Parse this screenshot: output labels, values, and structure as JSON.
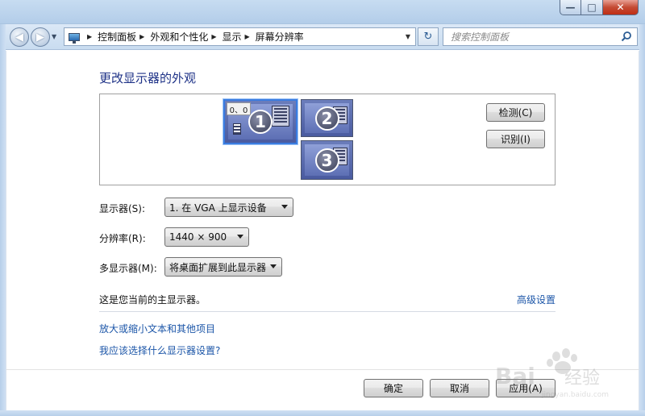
{
  "window": {
    "min_glyph": "—",
    "max_glyph": "□",
    "close_glyph": "✕"
  },
  "nav": {
    "back_glyph": "◀",
    "forward_glyph": "▶",
    "history_glyph": "▼"
  },
  "address": {
    "icon": "display-control-panel-icon",
    "breadcrumbs": [
      "控制面板",
      "外观和个性化",
      "显示",
      "屏幕分辨率"
    ],
    "dropdown_glyph": "▼",
    "refresh_glyph": "↻"
  },
  "search": {
    "placeholder": "搜索控制面板",
    "icon": "search-icon"
  },
  "main": {
    "title": "更改显示器的外观",
    "monitors": [
      {
        "number": "1",
        "selected": true,
        "coord_label": "0、0"
      },
      {
        "number": "2",
        "selected": false
      },
      {
        "number": "3",
        "selected": false
      }
    ],
    "detect_label": "检测(C)",
    "identify_label": "识别(I)",
    "display_label": "显示器(S):",
    "display_value": "1. 在 VGA 上显示设备",
    "resolution_label": "分辨率(R):",
    "resolution_value": "1440 × 900",
    "multi_label": "多显示器(M):",
    "multi_value": "将桌面扩展到此显示器",
    "info_text": "这是您当前的主显示器。",
    "advanced_link": "高级设置",
    "zoom_link": "放大或缩小文本和其他项目",
    "which_link": "我应该选择什么显示器设置?"
  },
  "footer": {
    "ok_label": "确定",
    "cancel_label": "取消",
    "apply_label": "应用(A)"
  },
  "watermark": {
    "text": "Baidu经验",
    "sub": "jingyan.baidu.com"
  },
  "colors": {
    "title_blue": "#1e3287",
    "link_blue": "#1c56a8",
    "selected_border": "#3a7ce0"
  }
}
